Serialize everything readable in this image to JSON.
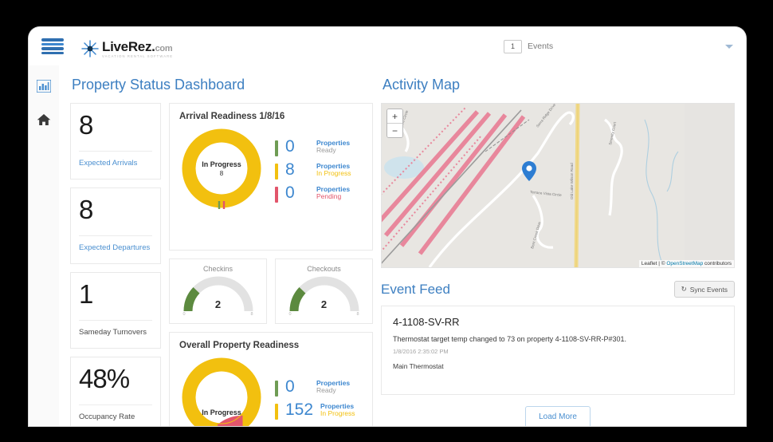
{
  "header": {
    "logo_main": "LiveRez.",
    "logo_dotcom": "com",
    "logo_tagline": "VACATION RENTAL SOFTWARE",
    "menu_icon": "hamburger-menu-icon",
    "events_badge": "1",
    "events_label": "Events",
    "chevron_icon": "chevron-down-icon"
  },
  "rail": {
    "items": [
      {
        "name": "dashboard-chart-icon",
        "label": "Dashboard"
      },
      {
        "name": "home-icon",
        "label": "Home"
      }
    ]
  },
  "left": {
    "page_title": "Property Status Dashboard",
    "stats": [
      {
        "value": "8",
        "label": "Expected Arrivals"
      },
      {
        "value": "8",
        "label": "Expected Departures"
      },
      {
        "value": "1",
        "label": "Sameday Turnovers"
      },
      {
        "value": "48%",
        "label": "Occupancy Rate"
      }
    ],
    "arrival_readiness": {
      "title": "Arrival Readiness 1/8/16",
      "donut_label": "In Progress",
      "donut_value": "8",
      "legend": [
        {
          "count": "0",
          "word1": "Properties",
          "word2": "Ready",
          "color": "#6f9c54"
        },
        {
          "count": "8",
          "word1": "Properties",
          "word2": "In Progress",
          "color": "#f2c00f"
        },
        {
          "count": "0",
          "word1": "Properties",
          "word2": "Pending",
          "color": "#e2556b"
        }
      ]
    },
    "gauges": [
      {
        "title": "Checkins",
        "value": "2",
        "min": "0",
        "max": "8"
      },
      {
        "title": "Checkouts",
        "value": "2",
        "min": "0",
        "max": "8"
      }
    ],
    "overall_readiness": {
      "title": "Overall Property Readiness",
      "donut_label": "In Progress",
      "legend": [
        {
          "count": "0",
          "word1": "Properties",
          "word2": "Ready",
          "color": "#6f9c54"
        },
        {
          "count": "152",
          "word1": "Properties",
          "word2": "In Progress",
          "color": "#f2c00f"
        }
      ]
    }
  },
  "right": {
    "map_title": "Activity Map",
    "map": {
      "zoom_in": "+",
      "zoom_out": "−",
      "attribution_prefix": "Leaflet",
      "attribution_sep": " | © ",
      "attribution_osm": "OpenStreetMap",
      "attribution_suffix": " contributors",
      "labels": [
        "Terrace Vista Circle",
        "Old Lake Wilson Road",
        "Serra Ridge Drive",
        "Serenity Court",
        "Bent Creek Drive",
        "Bay Oaks Circle"
      ],
      "pin_icon": "map-pin-icon"
    },
    "feed_title": "Event Feed",
    "sync_label": "Sync Events",
    "sync_icon": "refresh-icon",
    "event": {
      "title": "4-1108-SV-RR",
      "description": "Thermostat target temp changed to 73 on property 4-1108-SV-RR-P#301.",
      "timestamp": "1/8/2016 2:35:02 PM",
      "source": "Main Thermostat"
    },
    "load_more": "Load More"
  },
  "colors": {
    "accent_blue": "#3d7fc1",
    "yellow": "#f2c00f",
    "green": "#6f9c54",
    "red": "#e2556b"
  }
}
